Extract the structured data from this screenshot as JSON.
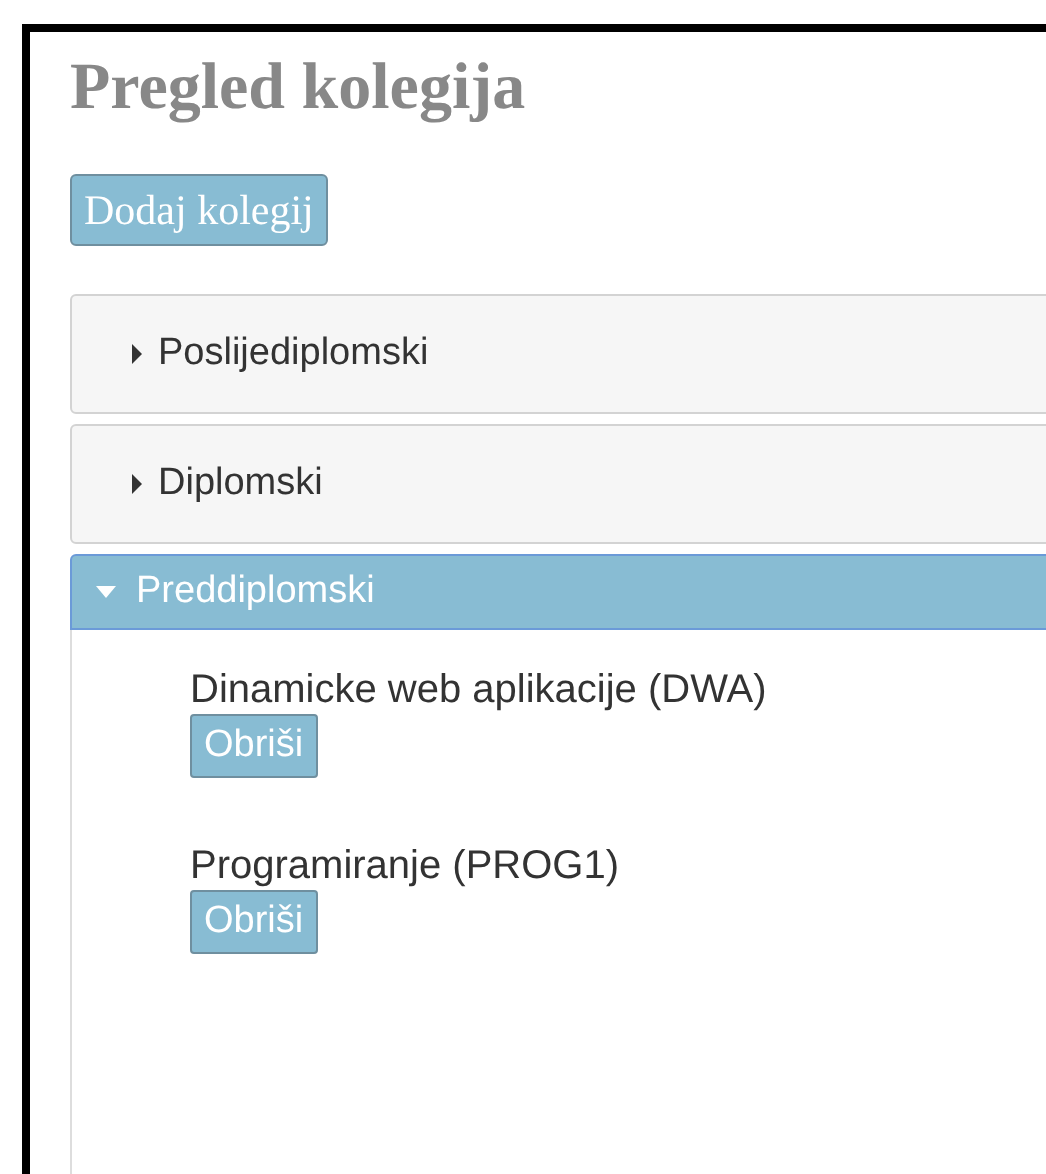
{
  "title": "Pregled kolegija",
  "add_button": "Dodaj kolegij",
  "sections": [
    {
      "label": "Poslijediplomski",
      "expanded": false
    },
    {
      "label": "Diplomski",
      "expanded": false
    },
    {
      "label": "Preddiplomski",
      "expanded": true,
      "courses": [
        {
          "name": "Dinamicke web aplikacije (DWA)",
          "button": "Obriši"
        },
        {
          "name": "Programiranje (PROG1)",
          "button": "Obriši"
        }
      ]
    }
  ]
}
